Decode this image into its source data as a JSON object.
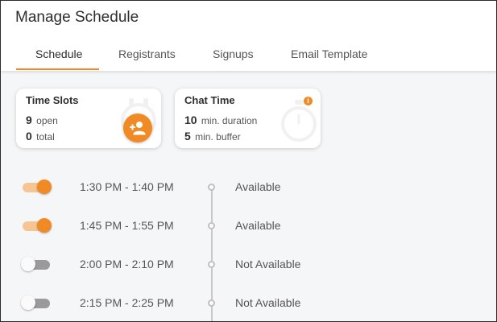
{
  "header": {
    "title": "Manage Schedule"
  },
  "tabs": [
    {
      "label": "Schedule",
      "active": true
    },
    {
      "label": "Registrants",
      "active": false
    },
    {
      "label": "Signups",
      "active": false
    },
    {
      "label": "Email Template",
      "active": false
    }
  ],
  "cards": {
    "time_slots": {
      "title": "Time Slots",
      "open_count": "9",
      "open_label": "open",
      "total_count": "0",
      "total_label": "total",
      "action_icon": "person-add-icon"
    },
    "chat_time": {
      "title": "Chat Time",
      "duration_value": "10",
      "duration_label": "min. duration",
      "buffer_value": "5",
      "buffer_label": "min. buffer",
      "info_icon": "info-icon"
    }
  },
  "slots": [
    {
      "time": "1:30 PM - 1:40 PM",
      "status": "Available",
      "enabled": true
    },
    {
      "time": "1:45 PM - 1:55 PM",
      "status": "Available",
      "enabled": true
    },
    {
      "time": "2:00 PM - 2:10 PM",
      "status": "Not Available",
      "enabled": false
    },
    {
      "time": "2:15 PM - 2:25 PM",
      "status": "Not Available",
      "enabled": false
    }
  ],
  "colors": {
    "accent": "#f08a24",
    "accent_light": "#f7c493",
    "toggle_off_track": "#9a9a9a"
  }
}
